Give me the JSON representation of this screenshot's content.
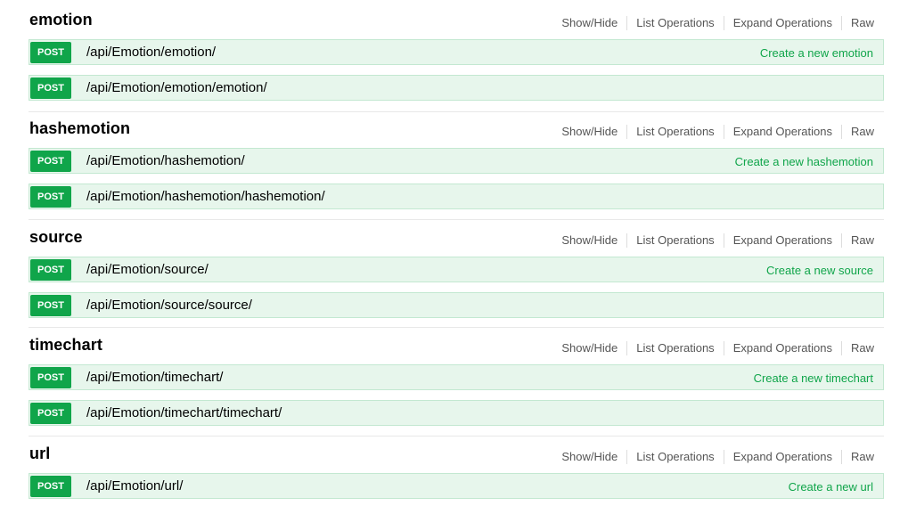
{
  "resources": [
    {
      "name": "emotion",
      "links": [
        "Show/Hide",
        "List Operations",
        "Expand Operations",
        "Raw"
      ],
      "operations": [
        {
          "method": "POST",
          "path": "/api/Emotion/emotion/",
          "summary": "Create a new emotion"
        },
        {
          "method": "POST",
          "path": "/api/Emotion/emotion/emotion/",
          "summary": ""
        }
      ]
    },
    {
      "name": "hashemotion",
      "links": [
        "Show/Hide",
        "List Operations",
        "Expand Operations",
        "Raw"
      ],
      "operations": [
        {
          "method": "POST",
          "path": "/api/Emotion/hashemotion/",
          "summary": "Create a new hashemotion"
        },
        {
          "method": "POST",
          "path": "/api/Emotion/hashemotion/hashemotion/",
          "summary": ""
        }
      ]
    },
    {
      "name": "source",
      "links": [
        "Show/Hide",
        "List Operations",
        "Expand Operations",
        "Raw"
      ],
      "operations": [
        {
          "method": "POST",
          "path": "/api/Emotion/source/",
          "summary": "Create a new source"
        },
        {
          "method": "POST",
          "path": "/api/Emotion/source/source/",
          "summary": ""
        }
      ]
    },
    {
      "name": "timechart",
      "links": [
        "Show/Hide",
        "List Operations",
        "Expand Operations",
        "Raw"
      ],
      "operations": [
        {
          "method": "POST",
          "path": "/api/Emotion/timechart/",
          "summary": "Create a new timechart"
        },
        {
          "method": "POST",
          "path": "/api/Emotion/timechart/timechart/",
          "summary": ""
        }
      ]
    },
    {
      "name": "url",
      "links": [
        "Show/Hide",
        "List Operations",
        "Expand Operations",
        "Raw"
      ],
      "operations": [
        {
          "method": "POST",
          "path": "/api/Emotion/url/",
          "summary": "Create a new url"
        }
      ]
    }
  ],
  "colors": {
    "post_method": "#10a54a",
    "post_row_bg": "#e7f6ec",
    "post_row_border": "#c3e8d1",
    "summary_text": "#10a54a"
  }
}
